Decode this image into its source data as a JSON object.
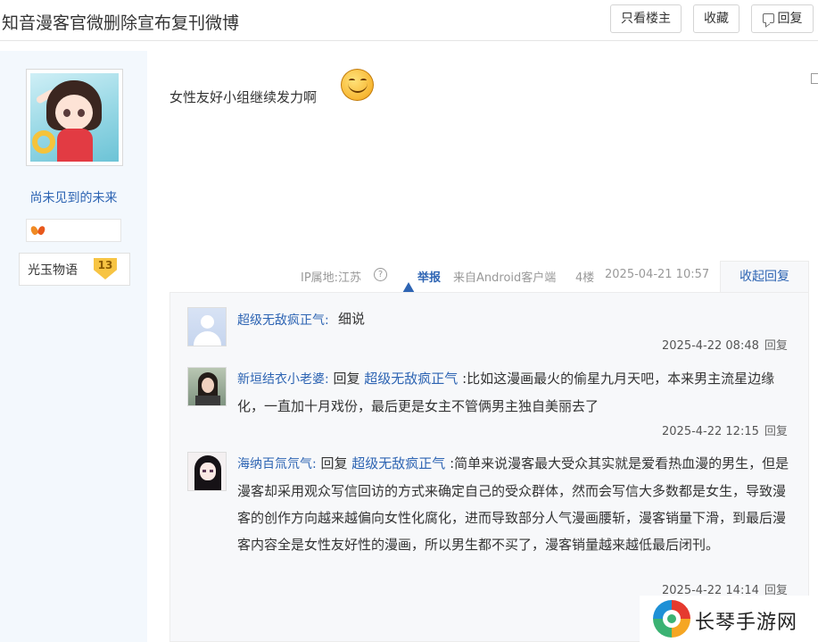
{
  "header": {
    "title": "知音漫客官微删除宣布复刊微博",
    "only_author_label": "只看楼主",
    "favorite_label": "收藏",
    "reply_label": "回复"
  },
  "author": {
    "username": "尚未见到的未来",
    "badge_name": "光玉物语",
    "level": "13",
    "avatar_icon": "anime-girl-avatar",
    "tag_icon": "paw-icon"
  },
  "post": {
    "text": "女性友好小组继续发力啊",
    "emoji": "smiley-face-icon",
    "ip_location": "IP属地:江苏",
    "report_label": "举报",
    "client": "来自Android客户端",
    "floor": "4楼",
    "datetime": "2025-04-21 10:57",
    "collapse_label": "收起回复"
  },
  "replies": [
    {
      "name": "超级无敌疯正气:",
      "text": "细说",
      "time": "2025-4-22 08:48",
      "reply_label": "回复"
    },
    {
      "name": "新垣结衣小老婆:",
      "prefix": "回复",
      "target": "超级无敌疯正气",
      "text": ":比如这漫画最火的偷星九月天吧，本来男主流星边缘化，一直加十月戏份，最后更是女主不管俩男主独自美丽去了",
      "time": "2025-4-22 12:15",
      "reply_label": "回复"
    },
    {
      "name": "海纳百氚氘气:",
      "prefix": "回复",
      "target": "超级无敌疯正气",
      "text": ":简单来说漫客最大受众其实就是爱看热血漫的男生，但是漫客却采用观众写信回访的方式来确定自己的受众群体，然而会写信大多数都是女生，导致漫客的创作方向越来越偏向女性化腐化，进而导致部分人气漫画腰斩，漫客销量下滑，到最后漫客内容全是女性友好性的漫画，所以男生都不买了，漫客销量越来越低最后闭刊。",
      "time": "2025-4-22 14:14",
      "reply_label": "回复"
    }
  ],
  "watermark": {
    "text": "长琴手游网"
  },
  "colors": {
    "link": "#2d64b3",
    "sidebar_bg": "#f3f8fd",
    "reply_panel_bg": "#f7f8fa"
  }
}
